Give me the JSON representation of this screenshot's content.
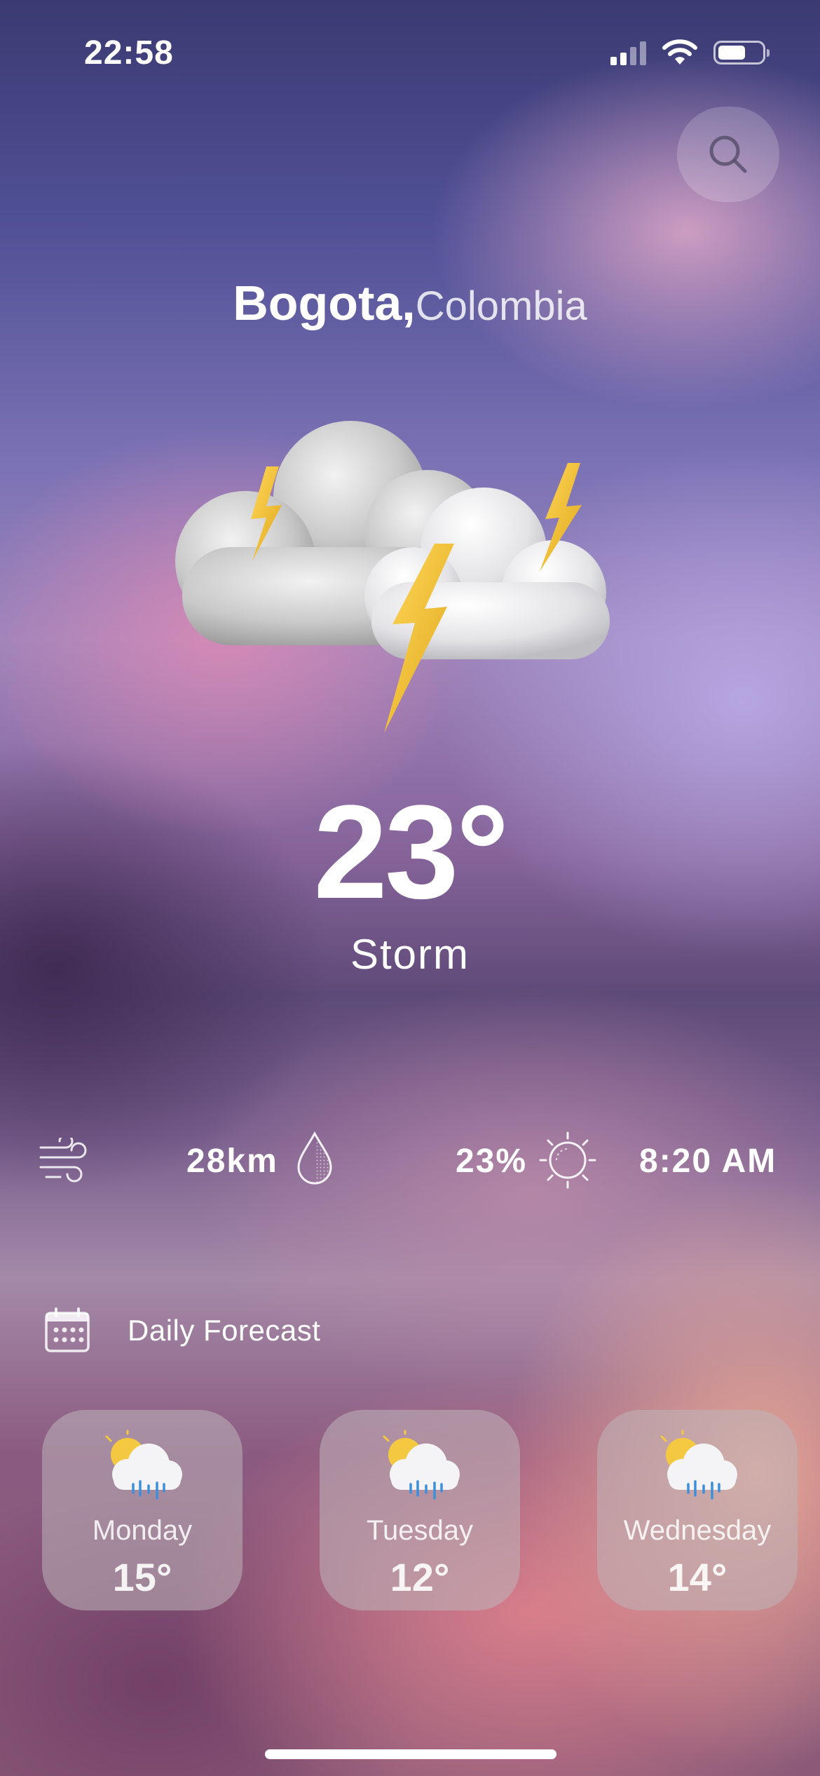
{
  "status_bar": {
    "time": "22:58",
    "signal_bars_active": 2,
    "signal_bars_total": 4,
    "battery_level": 0.6
  },
  "search": {
    "icon": "search-icon"
  },
  "location": {
    "city": "Bogota,",
    "country": "Colombia"
  },
  "current": {
    "icon": "storm-clouds-lightning-icon",
    "temperature": "23°",
    "condition": "Storm"
  },
  "stats": {
    "wind": {
      "icon": "wind-icon",
      "value": "28km"
    },
    "humidity": {
      "icon": "water-drop-icon",
      "value": "23%"
    },
    "sunrise": {
      "icon": "sun-icon",
      "value": "8:20 AM"
    }
  },
  "daily": {
    "icon": "calendar-icon",
    "title": "Daily Forecast",
    "days": [
      {
        "day": "Monday",
        "temp": "15°",
        "icon": "sun-cloud-rain-icon"
      },
      {
        "day": "Tuesday",
        "temp": "12°",
        "icon": "sun-cloud-rain-icon"
      },
      {
        "day": "Wednesday",
        "temp": "14°",
        "icon": "sun-cloud-rain-icon"
      }
    ]
  },
  "colors": {
    "lightning": "#f2c12e",
    "cloud": "#d9d9d9",
    "rain": "#3f8fd8",
    "sun": "#f5c842"
  }
}
